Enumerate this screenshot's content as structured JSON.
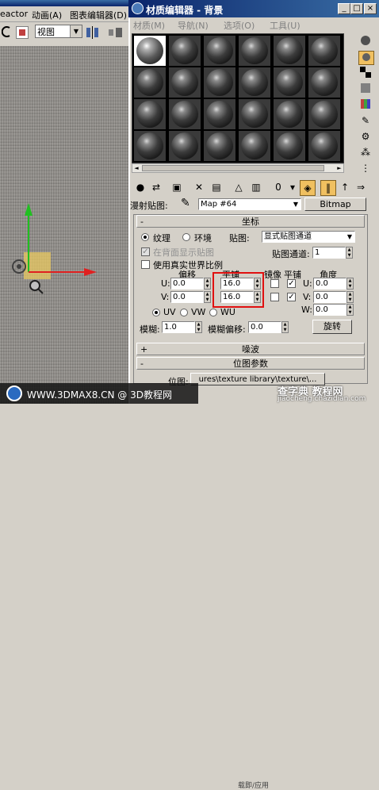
{
  "left_app": {
    "menu": [
      "eactor",
      "动画(A)",
      "图表编辑器(D)"
    ],
    "view_select": "视图"
  },
  "window": {
    "title": "材质编辑器 - 背景",
    "controls": [
      "_",
      "□",
      "×"
    ]
  },
  "me_menu": [
    "材质(M)",
    "导航(N)",
    "选项(O)",
    "工具(U)"
  ],
  "map_row": {
    "label": "漫射贴图:",
    "map_name": "Map #64",
    "type_button": "Bitmap"
  },
  "coords": {
    "header": "坐标",
    "texture_label": "纹理",
    "env_label": "环境",
    "mapping_label": "贴图:",
    "mapping_value": "显式贴图通道",
    "show_back_label": "在背面显示贴图",
    "channel_label": "贴图通道:",
    "channel_value": "1",
    "real_world_label": "使用真实世界比例",
    "offset_label": "偏移",
    "tiling_label": "平铺",
    "mirror_label": "镜像",
    "tile_label": "平铺",
    "angle_label": "角度",
    "u_label": "U:",
    "v_label": "V:",
    "w_label": "W:",
    "u_offset": "0.0",
    "v_offset": "0.0",
    "u_tiling": "16.0",
    "v_tiling": "16.0",
    "u_angle": "0.0",
    "v_angle": "0.0",
    "w_angle": "0.0",
    "uv": "UV",
    "vw": "VW",
    "wu": "WU",
    "blur_label": "模糊:",
    "blur_value": "1.0",
    "blur_offset_label": "模糊偏移:",
    "blur_offset_value": "0.0",
    "rotate_button": "旋转"
  },
  "noise_header": "噪波",
  "bitmap_header": "位图参数",
  "bitmap_path_label": "位图:",
  "bitmap_path": "ures\\texture library\\texture\\...",
  "bottom_hint": "载即/应用",
  "watermark": {
    "site": "WWW.3DMAX8.CN @ 3D教程网",
    "right_brand": "查字典 教程网",
    "right_url": "jiaocheng.chazidian.com"
  },
  "colors": {
    "title_bar": "#0a246a",
    "highlight": "#e01010",
    "axis_y": "#20c020",
    "axis_x": "#e02020"
  }
}
